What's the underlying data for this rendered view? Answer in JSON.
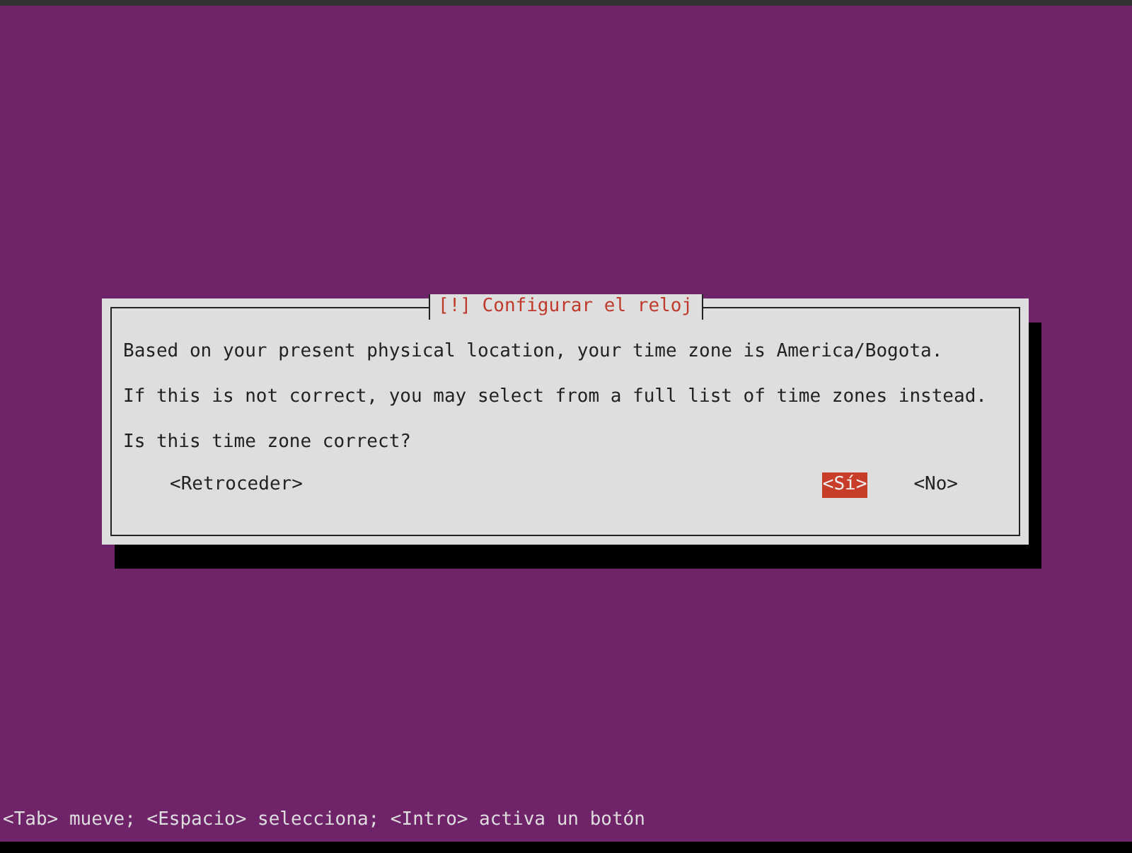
{
  "dialog": {
    "title": "[!] Configurar el reloj",
    "paragraphs": [
      "Based on your present physical location, your time zone is America/Bogota.",
      "If this is not correct, you may select from a full list of time zones instead.",
      "Is this time zone correct?"
    ],
    "buttons": [
      {
        "label": "<Retroceder>",
        "selected": false
      },
      {
        "label": "<Sí>",
        "selected": true
      },
      {
        "label": "<No>",
        "selected": false
      }
    ]
  },
  "status_bar": "<Tab> mueve; <Espacio> selecciona; <Intro> activa un botón"
}
